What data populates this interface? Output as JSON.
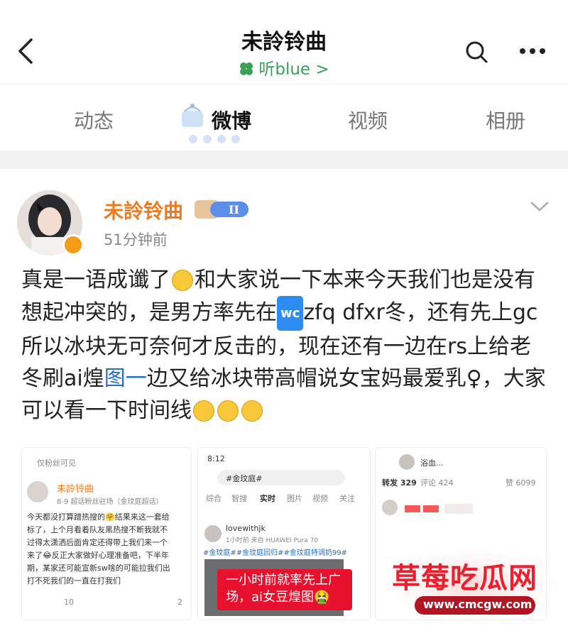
{
  "header": {
    "title": "未詅铃曲",
    "subtitle": "听blue >"
  },
  "tabs": [
    {
      "label": "动态"
    },
    {
      "label": "微博"
    },
    {
      "label": "视频"
    },
    {
      "label": "相册"
    }
  ],
  "post": {
    "username": "未詅铃曲",
    "level_badge": "II",
    "time": "51分钟前",
    "text_1": "真是一语成谶了",
    "text_2": "和大家说一下本来今天我们也是没有想起冲突的，是男方率先在",
    "wc_badge": "wc",
    "text_3": "zfq dfxr冬，还有先上gc所以冰块无可奈何才反击的，现在还有一边在rs上给老冬刷ai煌",
    "text_link": "图一",
    "text_4": "边又给冰块带高帽说女宝妈最爱乳♀，大家可以看一下时间线"
  },
  "image1": {
    "fans_only": "仅粉丝可见",
    "name": "未詅铃曲",
    "meta": "8-9  超话粉丝驻场（金玟庭超话）",
    "lines": [
      "今天都没打算蹭热搜的🤗结果来这一套给",
      "标了，上个月看着队友黑热搜不断我就不",
      "过得太潇洒后面肯定还得带上我们来一个",
      "来了😂反正大家做好心理准备吧，下半年",
      "期，某家还可能宣新sw啥的可能拉我们出",
      "打不死我们的一直在打我们"
    ],
    "comments": "10",
    "likes": "2"
  },
  "image2": {
    "status_time": "8:12",
    "search": "#金玟庭#",
    "tabs": [
      "综合",
      "智搜",
      "实时",
      "图片",
      "视频",
      "关注"
    ],
    "user": "lovewithjk",
    "meta": "1小时前  来自 HUAWEI Pura 70",
    "tags": "#金玟庭##金玟庭回归##金玟庭特调奶99#",
    "overlay": "一小时前就率先上广场，ai女豆煌图🤮"
  },
  "image3": {
    "name": "浴血...",
    "repost": "转发 329",
    "comment": "评论 424",
    "like": "赞 6099"
  },
  "watermark": {
    "title": "草莓吃瓜网",
    "url": "www.cmcgw.com"
  },
  "colors": {
    "accent_orange": "#f07a1d",
    "green": "#3aa05b",
    "link_blue": "#2a6fbd",
    "red": "#e8112d"
  }
}
